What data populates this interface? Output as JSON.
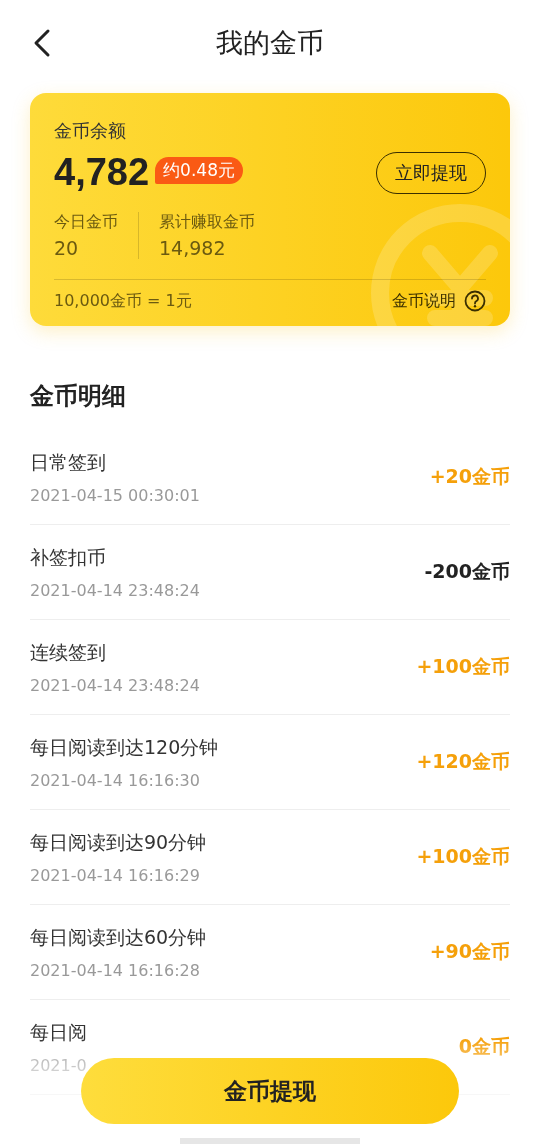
{
  "header": {
    "title": "我的金币"
  },
  "balance_card": {
    "label": "金币余额",
    "amount": "4,782",
    "approx": "约0.48元",
    "withdraw_button": "立即提现",
    "stats": [
      {
        "label": "今日金币",
        "value": "20"
      },
      {
        "label": "累计赚取金币",
        "value": "14,982"
      }
    ],
    "rate": "10,000金币 = 1元",
    "help_link": "金币说明"
  },
  "details": {
    "title": "金币明细",
    "records": [
      {
        "title": "日常签到",
        "time": "2021-04-15 00:30:01",
        "amount": "+20金币",
        "kind": "income"
      },
      {
        "title": "补签扣币",
        "time": "2021-04-14 23:48:24",
        "amount": "-200金币",
        "kind": "expense"
      },
      {
        "title": "连续签到",
        "time": "2021-04-14 23:48:24",
        "amount": "+100金币",
        "kind": "income"
      },
      {
        "title": "每日阅读到达120分钟",
        "time": "2021-04-14 16:16:30",
        "amount": "+120金币",
        "kind": "income"
      },
      {
        "title": "每日阅读到达90分钟",
        "time": "2021-04-14 16:16:29",
        "amount": "+100金币",
        "kind": "income"
      },
      {
        "title": "每日阅读到达60分钟",
        "time": "2021-04-14 16:16:28",
        "amount": "+90金币",
        "kind": "income"
      },
      {
        "title": "每日阅",
        "time": "2021-0",
        "amount": "0金币",
        "kind": "income"
      }
    ]
  },
  "bottom_button": "金币提现"
}
